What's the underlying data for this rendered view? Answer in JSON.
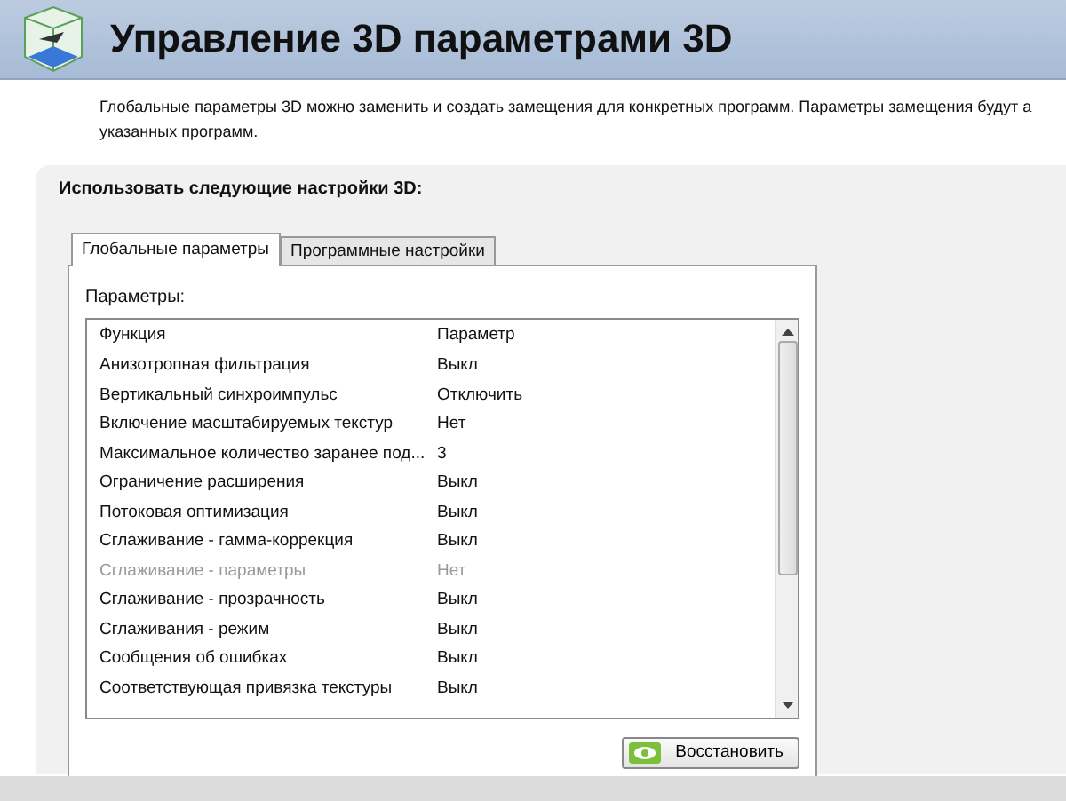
{
  "header": {
    "title": "Управление 3D параметрами 3D"
  },
  "description_lines": [
    "Глобальные параметры 3D можно заменить и создать замещения для конкретных программ. Параметры замещения будут а",
    "указанных программ."
  ],
  "panel": {
    "label": "Использовать следующие настройки 3D:"
  },
  "tabs": [
    {
      "label": "Глобальные параметры",
      "selected": true
    },
    {
      "label": "Программные настройки",
      "selected": false
    }
  ],
  "settings": {
    "label": "Параметры:",
    "columns": [
      "Функция",
      "Параметр"
    ],
    "rows": [
      {
        "function": "Анизотропная фильтрация",
        "value": "Выкл",
        "disabled": false
      },
      {
        "function": "Вертикальный синхроимпульс",
        "value": "Отключить",
        "disabled": false
      },
      {
        "function": "Включение масштабируемых текстур",
        "value": "Нет",
        "disabled": false
      },
      {
        "function": "Максимальное количество заранее под...",
        "value": "3",
        "disabled": false
      },
      {
        "function": "Ограничение расширения",
        "value": "Выкл",
        "disabled": false
      },
      {
        "function": "Потоковая оптимизация",
        "value": "Выкл",
        "disabled": false
      },
      {
        "function": "Сглаживание - гамма-коррекция",
        "value": "Выкл",
        "disabled": false
      },
      {
        "function": "Сглаживание - параметры",
        "value": "Нет",
        "disabled": true
      },
      {
        "function": "Сглаживание - прозрачность",
        "value": "Выкл",
        "disabled": false
      },
      {
        "function": "Сглаживания - режим",
        "value": "Выкл",
        "disabled": false
      },
      {
        "function": "Сообщения об ошибках",
        "value": "Выкл",
        "disabled": false
      },
      {
        "function": "Соответствующая привязка текстуры",
        "value": "Выкл",
        "disabled": false
      }
    ]
  },
  "restore_button": {
    "label": "Восстановить"
  }
}
